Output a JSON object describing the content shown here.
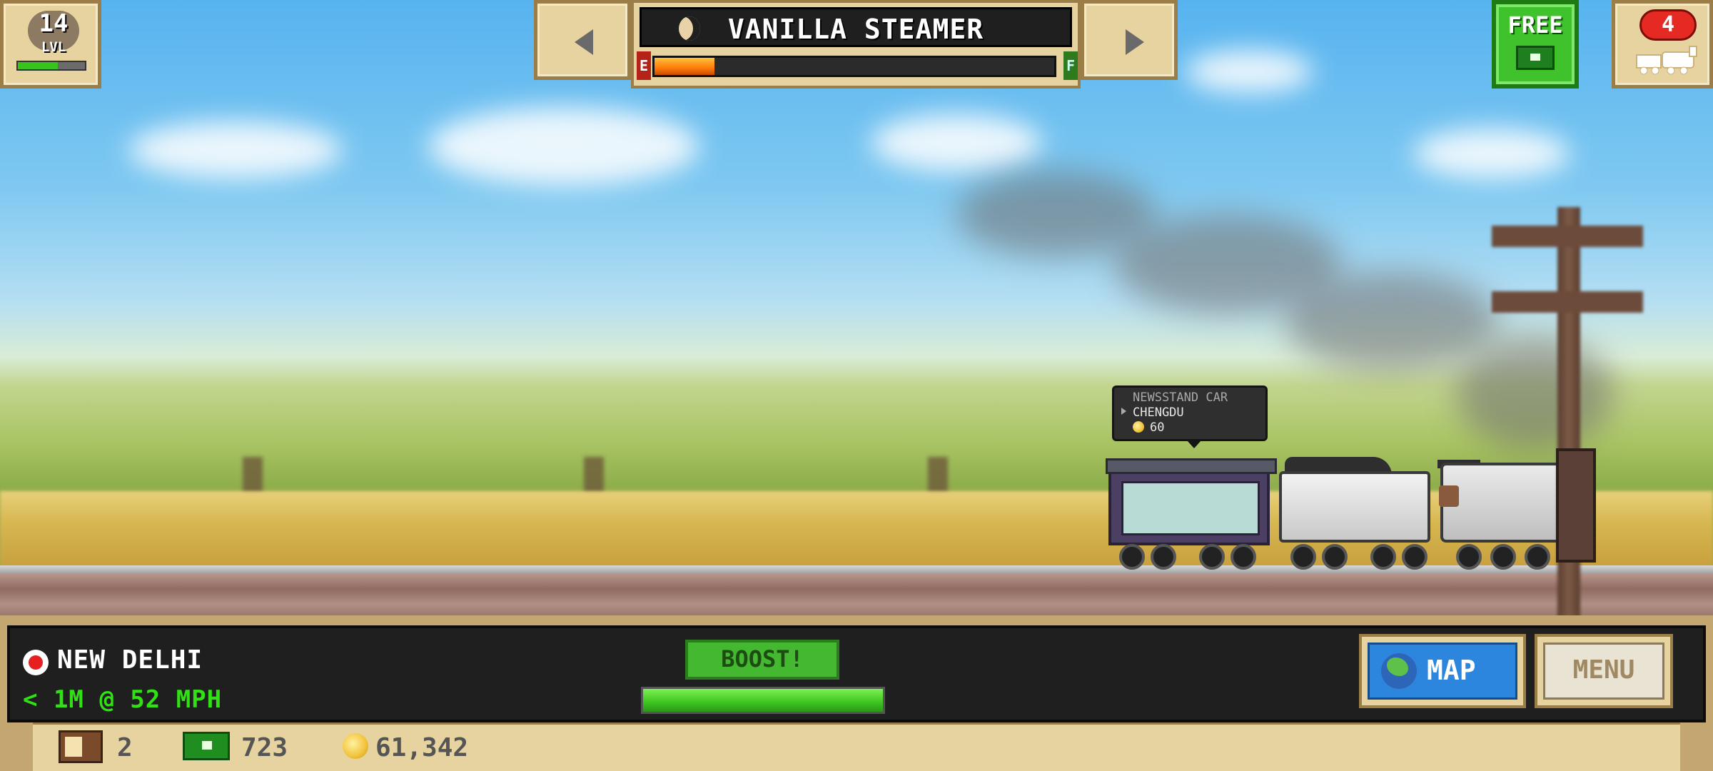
{
  "hud": {
    "level": {
      "number": "14",
      "label": "LVL",
      "progress_fraction": 0.6
    },
    "train": {
      "name": "VANILLA STEAMER",
      "fuel_fraction": 0.15,
      "fuel_empty_label": "E",
      "fuel_full_label": "F"
    },
    "free_button": {
      "label": "FREE"
    },
    "train_count": {
      "count": "4"
    }
  },
  "tooltip": {
    "car_type": "NEWSSTAND CAR",
    "destination": "CHENGDU",
    "reward": "60"
  },
  "status": {
    "station": "NEW DELHI",
    "distance": "< 1M @ 52 MPH",
    "boost_label": "BOOST!",
    "boost_fraction": 1.0
  },
  "buttons": {
    "map_label": "MAP",
    "menu_label": "MENU"
  },
  "resources": {
    "crates": "2",
    "cash": "723",
    "coins": "61,342"
  },
  "icons": [
    "moon-icon",
    "free-cash-icon",
    "train-icon",
    "station-icon",
    "globe-icon",
    "crate-icon",
    "cash-icon",
    "coin-icon",
    "arrow-left-icon",
    "arrow-right-icon"
  ],
  "colors": {
    "accent_green": "#3fc22c",
    "fuel_orange": "#ff7a0a",
    "alert_red": "#e52a23",
    "map_blue": "#2c86dd"
  }
}
